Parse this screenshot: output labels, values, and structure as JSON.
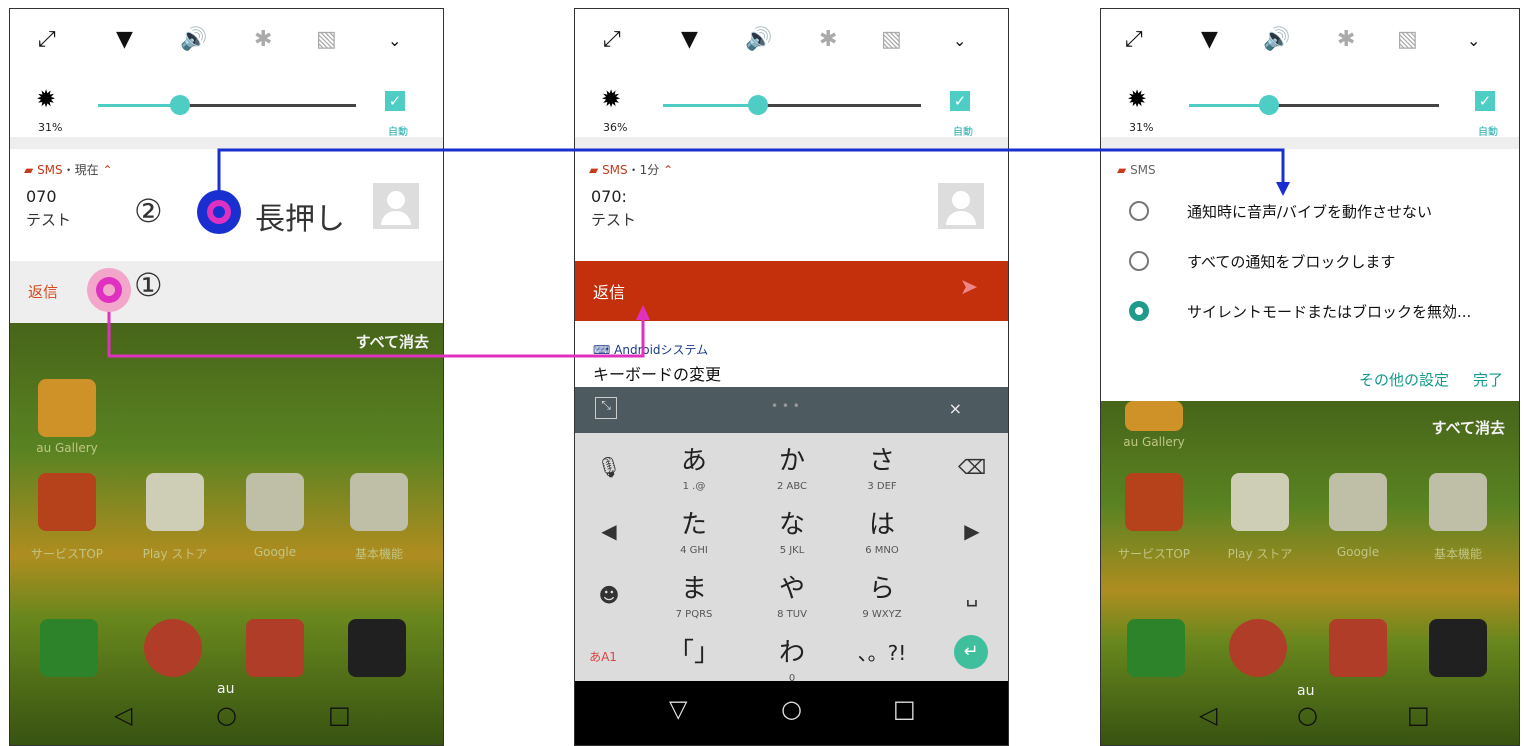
{
  "phone1": {
    "brightness_pct": "31%",
    "auto_label": "自動",
    "notif_app": "SMS",
    "notif_time": "・現在",
    "notif_sender": "070",
    "notif_body": "テスト",
    "reply_label": "返信",
    "clear_all": "すべて消去",
    "app_labels": [
      "au Gallery",
      "サービスTOP",
      "Play ストア",
      "Google",
      "基本機能"
    ],
    "carrier": "au"
  },
  "phone2": {
    "brightness_pct": "36%",
    "auto_label": "自動",
    "notif_app": "SMS",
    "notif_time": "・1分",
    "notif_sender": "070:",
    "notif_body": "テスト",
    "reply_label": "返信",
    "ime_source": "Androidシステム",
    "ime_change": "キーボードの変更",
    "keys": [
      {
        "k": "あ",
        "s": "1 .@"
      },
      {
        "k": "か",
        "s": "2 ABC"
      },
      {
        "k": "さ",
        "s": "3 DEF"
      },
      {
        "k": "た",
        "s": "4 GHI"
      },
      {
        "k": "な",
        "s": "5 JKL"
      },
      {
        "k": "は",
        "s": "6 MNO"
      },
      {
        "k": "ま",
        "s": "7 PQRS"
      },
      {
        "k": "や",
        "s": "8 TUV"
      },
      {
        "k": "ら",
        "s": "9 WXYZ"
      },
      {
        "k": "「」",
        "s": ""
      },
      {
        "k": "わ",
        "s": "0"
      },
      {
        "k": "、。?!",
        "s": ""
      }
    ],
    "mode_key": "あA1"
  },
  "phone3": {
    "brightness_pct": "31%",
    "auto_label": "自動",
    "dialog_app": "SMS",
    "options": [
      "通知時に音声/バイブを動作させない",
      "すべての通知をブロックします",
      "サイレントモードまたはブロックを無効..."
    ],
    "selected_option": 2,
    "more_settings": "その他の設定",
    "done": "完了",
    "clear_all": "すべて消去",
    "app_labels": [
      "au Gallery",
      "サービスTOP",
      "Play ストア",
      "Google",
      "基本機能"
    ],
    "carrier": "au"
  },
  "annotations": {
    "step1": "①",
    "step2": "②",
    "long_press": "長押し"
  },
  "colors": {
    "accent": "#4ecdc4",
    "reply_bar": "#c4300b",
    "arrow_blue": "#1a2fd0",
    "arrow_magenta": "#e030c0"
  }
}
